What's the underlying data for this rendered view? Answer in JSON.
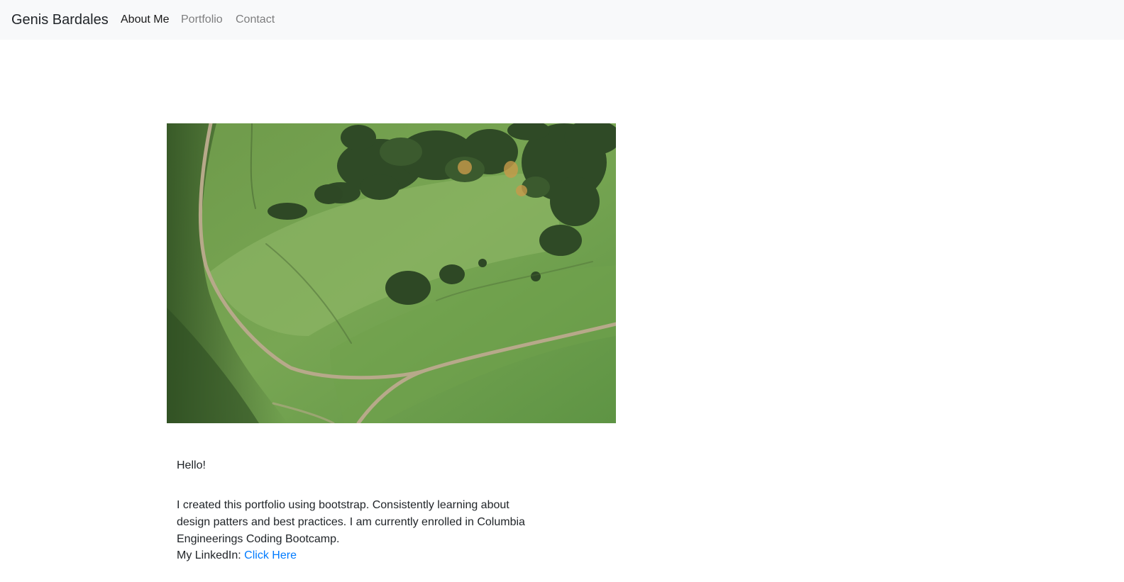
{
  "navbar": {
    "brand": "Genis Bardales",
    "links": [
      {
        "label": "About Me",
        "active": true
      },
      {
        "label": "Portfolio",
        "active": false
      },
      {
        "label": "Contact",
        "active": false
      }
    ]
  },
  "hero_image": {
    "description_icon": "aerial-landscape-image"
  },
  "about": {
    "greeting": "Hello!",
    "bio": "I created this portfolio using bootstrap. Consistently learning about design patters and best practices. I am currently enrolled in Columbia Engineerings Coding Bootcamp.",
    "linkedin_label": "My LinkedIn:",
    "linkedin_link_text": "Click Here"
  },
  "colors": {
    "navbar_bg": "#f8f9fa",
    "link": "#007bff",
    "text": "#212529"
  }
}
